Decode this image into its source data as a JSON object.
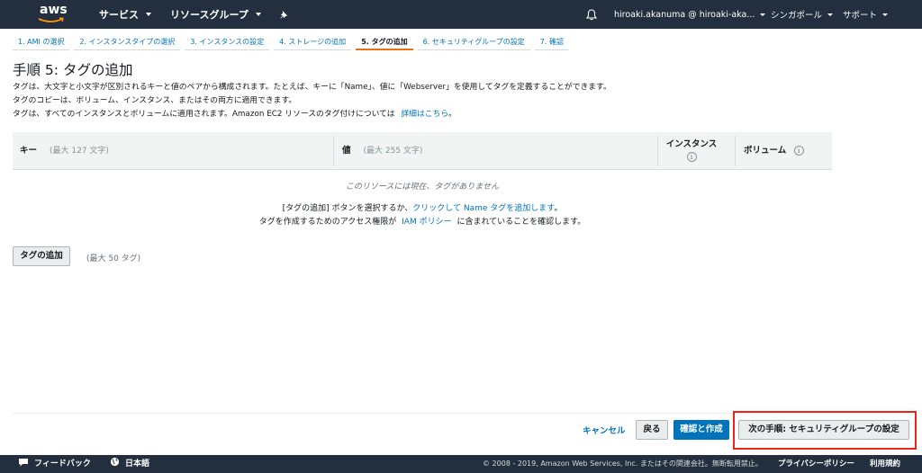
{
  "topnav": {
    "logo_text": "aws",
    "services_label": "サービス",
    "resource_groups_label": "リソースグループ",
    "account_label": "hiroaki.akanuma @ hiroaki-aka...",
    "region_label": "シンガポール",
    "support_label": "サポート"
  },
  "steps": [
    {
      "label": "1. AMI の選択",
      "active": false
    },
    {
      "label": "2. インスタンスタイプの選択",
      "active": false
    },
    {
      "label": "3. インスタンスの設定",
      "active": false
    },
    {
      "label": "4. ストレージの追加",
      "active": false
    },
    {
      "label": "5. タグの追加",
      "active": true
    },
    {
      "label": "6. セキュリティグループの設定",
      "active": false
    },
    {
      "label": "7. 確認",
      "active": false
    }
  ],
  "page": {
    "title": "手順 5: タグの追加",
    "desc_line1": "タグは、大文字と小文字が区別されるキーと値のペアから構成されます。たとえば、キーに「Name」、値に「Webserver」を使用してタグを定義することができます。",
    "desc_line2": "タグのコピーは、ボリューム、インスタンス、またはその両方に適用できます。",
    "desc_line3_prefix": "タグは、すべてのインスタンスとボリュームに適用されます。Amazon EC2 リソースのタグ付けについては",
    "desc_line3_link": "詳細はこちら",
    "desc_line3_suffix": "。"
  },
  "table": {
    "col_key": "キー",
    "col_key_hint": "(最大 127 文字)",
    "col_value": "値",
    "col_value_hint": "(最大 255 文字)",
    "col_instance": "インスタンス",
    "col_volume": "ボリューム",
    "info_glyph": "i",
    "empty_message": "このリソースには現在、タグがありません",
    "help1_prefix": "[タグの追加] ボタンを選択するか、",
    "help1_link": "クリックして Name タグを追加します",
    "help1_suffix": "。",
    "help2_prefix": "タグを作成するためのアクセス権限が",
    "help2_link": "IAM ポリシー",
    "help2_suffix": "に含まれていることを確認します。"
  },
  "actions": {
    "add_tag_label": "タグの追加",
    "max_tags_label": "(最大 50 タグ)",
    "cancel_label": "キャンセル",
    "back_label": "戻る",
    "review_launch_label": "確認と作成",
    "next_label": "次の手順: セキュリティグループの設定"
  },
  "footer": {
    "feedback_label": "フィードバック",
    "language_label": "日本語",
    "copyright": "© 2008 - 2019, Amazon Web Services, Inc. またはその関連会社。無断転用禁止。",
    "privacy_label": "プライバシーポリシー",
    "terms_label": "利用規約"
  },
  "colors": {
    "nav_bg": "#232f3e",
    "link": "#0073bb",
    "active_step": "#ec7211",
    "highlight": "#e8261a"
  }
}
